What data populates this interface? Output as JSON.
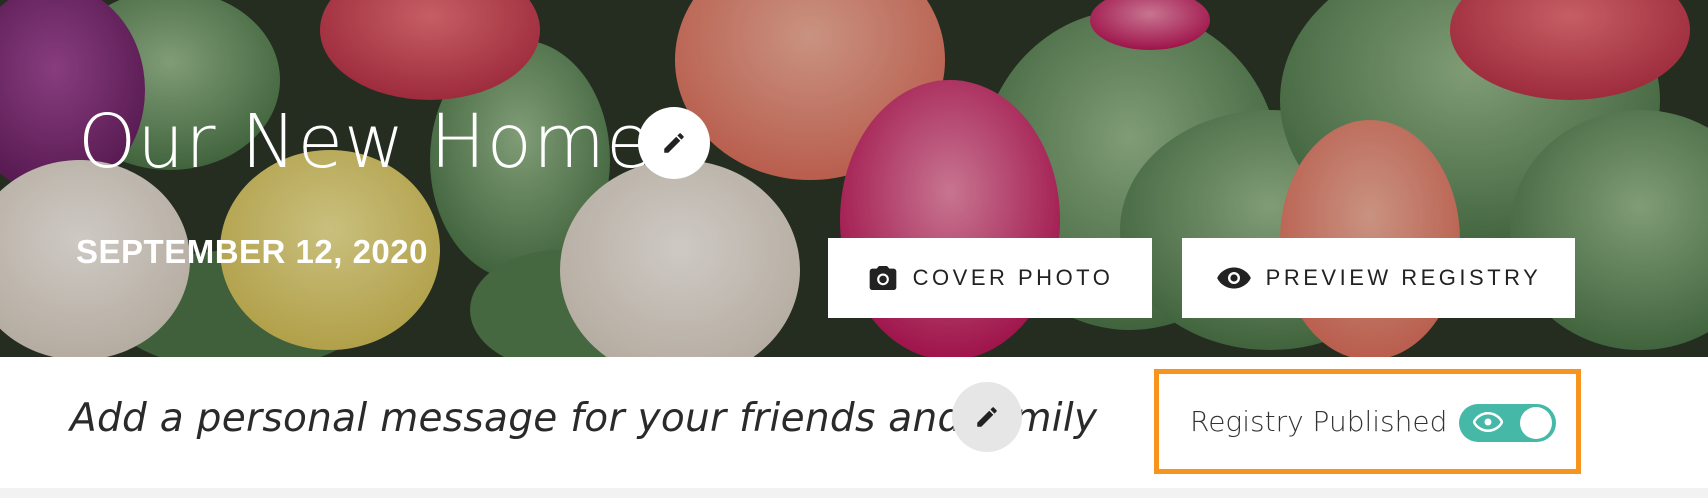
{
  "hero": {
    "title": "Our New Home!",
    "date": "SEPTEMBER 12, 2020",
    "cover_photo_label": "COVER PHOTO",
    "preview_registry_label": "PREVIEW REGISTRY"
  },
  "message_bar": {
    "message": "Add a personal message for your friends and family",
    "published_label": "Registry Published",
    "published_on": true
  },
  "colors": {
    "toggle": "#45b8a8",
    "highlight": "#f7941d"
  },
  "icons": [
    "pencil-icon",
    "camera-icon",
    "eye-icon"
  ]
}
